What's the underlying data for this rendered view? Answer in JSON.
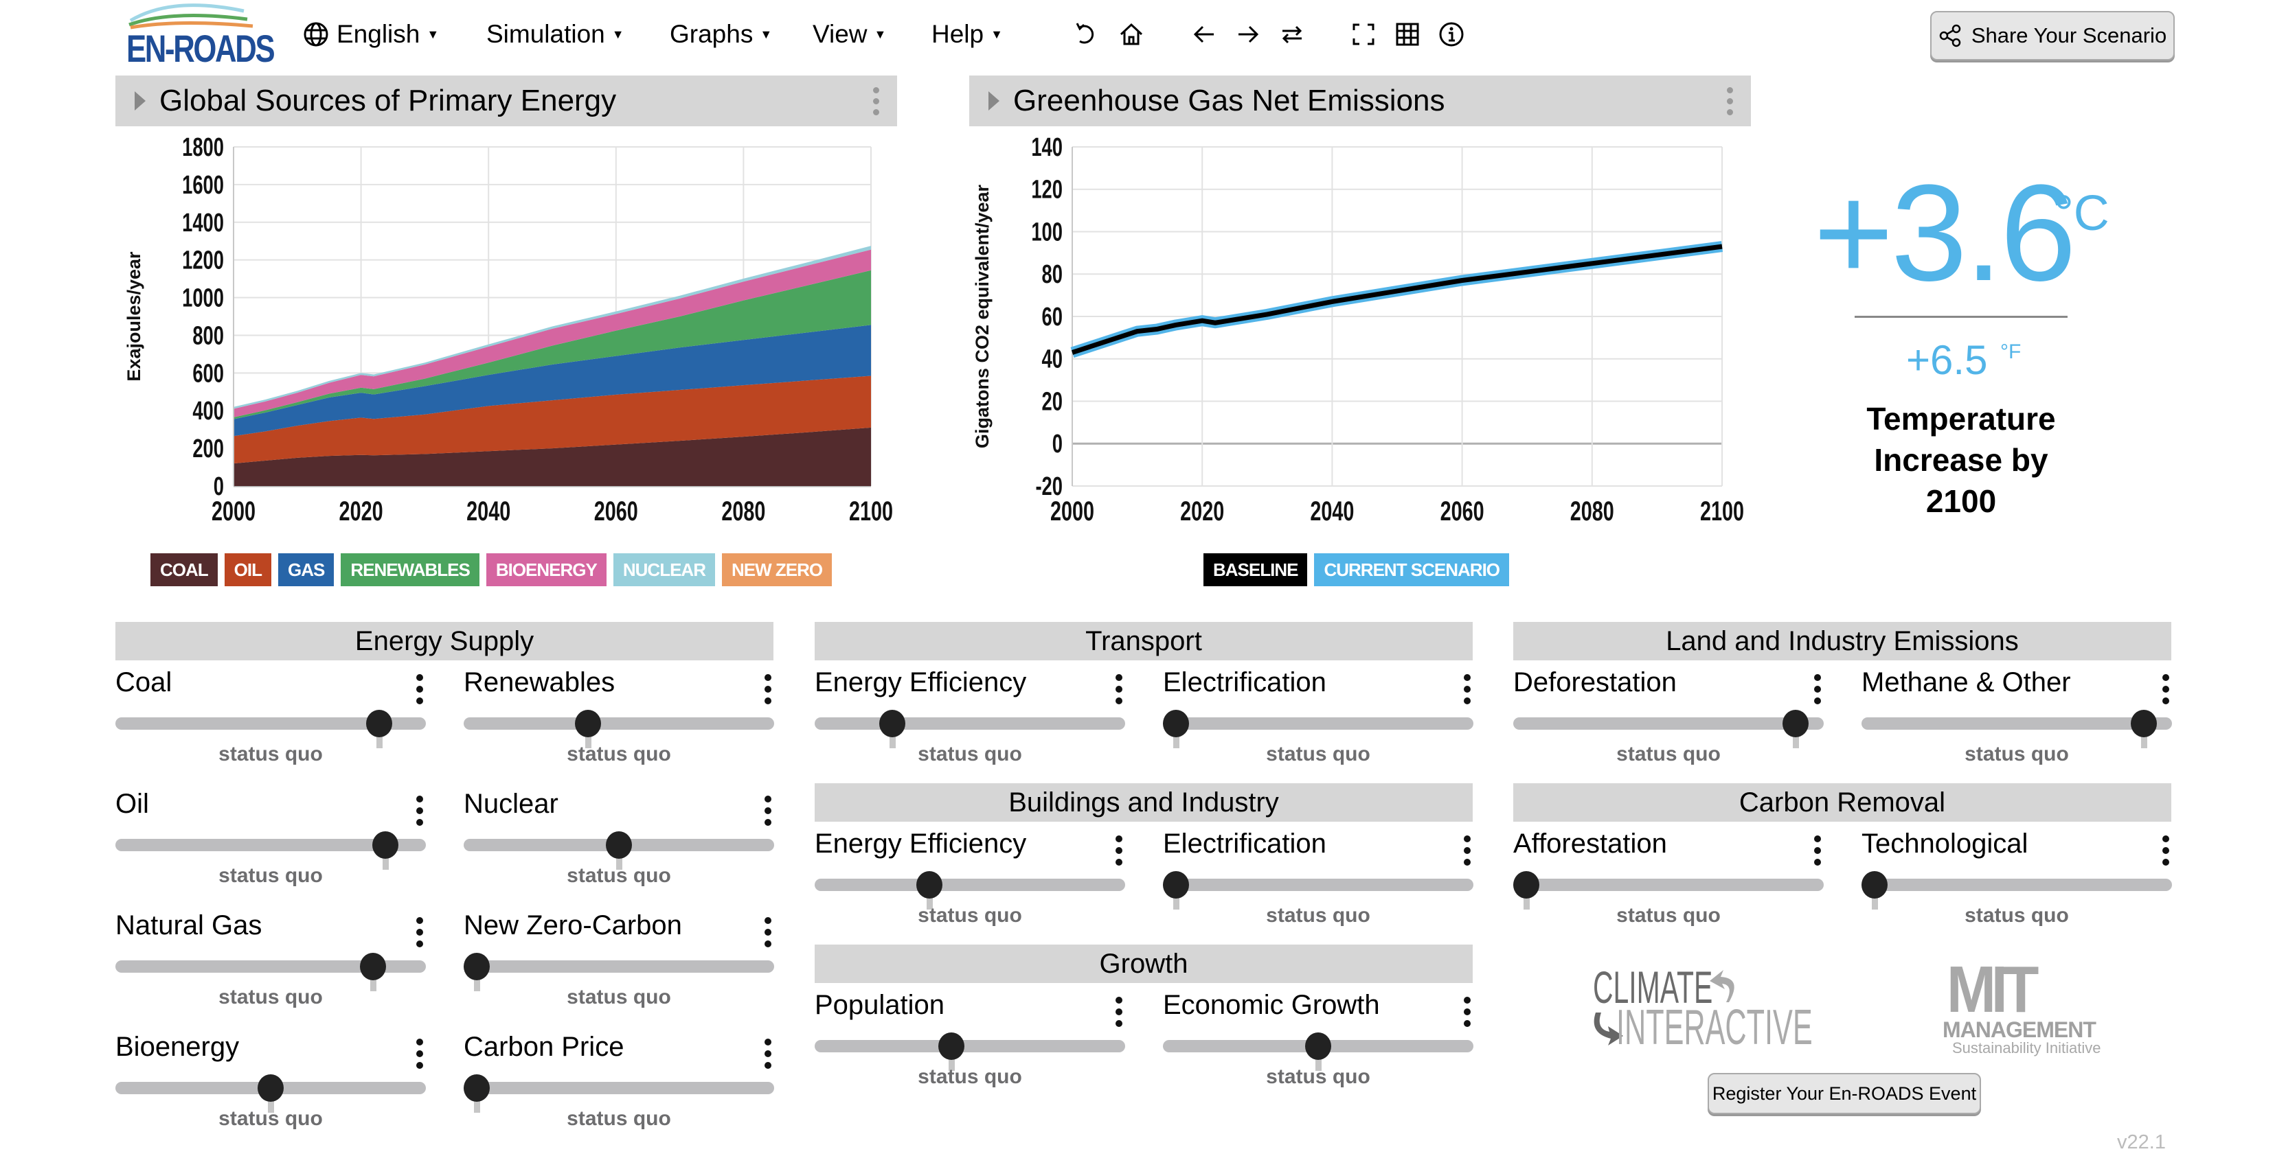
{
  "app": {
    "logo_text": "EN-ROADS",
    "version": "v22.1"
  },
  "menu": [
    {
      "label": "English",
      "icon": "globe-icon"
    },
    {
      "label": "Simulation"
    },
    {
      "label": "Graphs"
    },
    {
      "label": "View"
    },
    {
      "label": "Help"
    }
  ],
  "toolbar": {
    "icons": [
      "undo-icon",
      "home-icon",
      "back-arrow-icon",
      "forward-arrow-icon",
      "compare-icon",
      "fullscreen-icon",
      "table-icon",
      "info-icon"
    ],
    "share_label": "Share Your Scenario"
  },
  "charts": {
    "left_title": "Global Sources of Primary Energy",
    "right_title": "Greenhouse Gas Net Emissions"
  },
  "chart_data": [
    {
      "type": "area",
      "title": "Global Sources of Primary Energy",
      "xlabel": "",
      "ylabel": "Exajoules/year",
      "xlim": [
        2000,
        2100
      ],
      "ylim": [
        0,
        1800
      ],
      "yticks": [
        0,
        200,
        400,
        600,
        800,
        1000,
        1200,
        1400,
        1600,
        1800
      ],
      "xticks": [
        2000,
        2020,
        2040,
        2060,
        2080,
        2100
      ],
      "grid": true,
      "stacked": true,
      "x": [
        2000,
        2005,
        2010,
        2015,
        2020,
        2022,
        2030,
        2040,
        2050,
        2060,
        2070,
        2080,
        2090,
        2100
      ],
      "series": [
        {
          "name": "COAL",
          "color": "#532b2d",
          "values": [
            120,
            135,
            150,
            160,
            165,
            163,
            170,
            185,
            200,
            220,
            240,
            262,
            285,
            310
          ]
        },
        {
          "name": "OIL",
          "color": "#bc4521",
          "values": [
            145,
            155,
            170,
            185,
            198,
            193,
            210,
            240,
            255,
            265,
            270,
            273,
            275,
            275
          ]
        },
        {
          "name": "GAS",
          "color": "#2765a8",
          "values": [
            90,
            100,
            110,
            125,
            132,
            130,
            150,
            165,
            190,
            205,
            225,
            240,
            255,
            270
          ]
        },
        {
          "name": "RENEWABLES",
          "color": "#4ba45e",
          "values": [
            10,
            12,
            15,
            20,
            27,
            28,
            40,
            65,
            100,
            135,
            165,
            210,
            250,
            290
          ]
        },
        {
          "name": "BIOENERGY",
          "color": "#d565a0",
          "values": [
            45,
            47,
            50,
            58,
            68,
            68,
            75,
            85,
            90,
            88,
            95,
            100,
            105,
            110
          ]
        },
        {
          "name": "NUCLEAR",
          "color": "#97cfdb",
          "values": [
            10,
            10,
            10,
            10,
            10,
            10,
            10,
            12,
            12,
            14,
            15,
            16,
            17,
            20
          ]
        },
        {
          "name": "NEW ZERO",
          "color": "#eb9b61",
          "values": [
            0,
            0,
            0,
            0,
            0,
            0,
            0,
            0,
            0,
            0,
            0,
            0,
            0,
            0
          ]
        }
      ]
    },
    {
      "type": "line",
      "title": "Greenhouse Gas Net Emissions",
      "xlabel": "",
      "ylabel": "Gigatons CO2 equivalent/year",
      "xlim": [
        2000,
        2100
      ],
      "ylim": [
        -20,
        140
      ],
      "yticks": [
        -20,
        0,
        20,
        40,
        60,
        80,
        100,
        120,
        140
      ],
      "xticks": [
        2000,
        2020,
        2040,
        2060,
        2080,
        2100
      ],
      "grid": true,
      "x": [
        2000,
        2003,
        2006,
        2008,
        2010,
        2013,
        2016,
        2020,
        2022,
        2030,
        2040,
        2050,
        2060,
        2070,
        2080,
        2090,
        2100
      ],
      "series": [
        {
          "name": "BASELINE",
          "color": "#000000",
          "values": [
            43,
            46,
            49,
            51,
            53,
            54,
            56,
            58,
            57,
            61,
            67,
            72,
            77,
            81,
            85,
            89,
            93
          ]
        },
        {
          "name": "CURRENT SCENARIO",
          "color": "#52b4e8",
          "values": [
            43,
            46,
            49,
            51,
            53,
            54,
            56,
            58,
            57,
            61,
            67,
            72,
            77,
            81,
            85,
            89,
            93
          ]
        }
      ]
    }
  ],
  "temperature": {
    "celsius": "+3.6",
    "celsius_unit": "°C",
    "fahrenheit": "+6.5",
    "fahrenheit_unit": "°F",
    "label": "Temperature Increase by 2100"
  },
  "sections": [
    {
      "title": "Energy Supply"
    },
    {
      "title": "Transport"
    },
    {
      "title": "Buildings and Industry"
    },
    {
      "title": "Growth"
    },
    {
      "title": "Land and Industry Emissions"
    },
    {
      "title": "Carbon Removal"
    }
  ],
  "sliders": [
    {
      "label": "Coal",
      "value": 0.85,
      "status": "status quo"
    },
    {
      "label": "Renewables",
      "value": 0.4,
      "status": "status quo"
    },
    {
      "label": "Oil",
      "value": 0.87,
      "status": "status quo"
    },
    {
      "label": "Nuclear",
      "value": 0.5,
      "status": "status quo"
    },
    {
      "label": "Natural Gas",
      "value": 0.83,
      "status": "status quo"
    },
    {
      "label": "New Zero-Carbon",
      "value": 0.0,
      "status": "status quo"
    },
    {
      "label": "Bioenergy",
      "value": 0.5,
      "status": "status quo"
    },
    {
      "label": "Carbon Price",
      "value": 0.0,
      "status": "status quo"
    },
    {
      "label": "Energy Efficiency",
      "value": 0.25,
      "status": "status quo"
    },
    {
      "label": "Electrification",
      "value": 0.0,
      "status": "status quo"
    },
    {
      "label": "Energy Efficiency",
      "value": 0.37,
      "status": "status quo"
    },
    {
      "label": "Electrification",
      "value": 0.0,
      "status": "status quo"
    },
    {
      "label": "Population",
      "value": 0.44,
      "status": "status quo"
    },
    {
      "label": "Economic Growth",
      "value": 0.5,
      "status": "status quo"
    },
    {
      "label": "Deforestation",
      "value": 0.91,
      "status": "status quo"
    },
    {
      "label": "Methane & Other",
      "value": 0.91,
      "status": "status quo"
    },
    {
      "label": "Afforestation",
      "value": 0.0,
      "status": "status quo"
    },
    {
      "label": "Technological",
      "value": 0.0,
      "status": "status quo"
    }
  ],
  "footer": {
    "partner1": "CLIMATE INTERACTIVE",
    "partner1_line1": "CLIMATE",
    "partner1_line2": "INTERACTIVE",
    "partner2_line1": "MIT",
    "partner2_line2": "MANAGEMENT",
    "partner2_line3": "Sustainability Initiative",
    "register_label": "Register Your En-ROADS Event"
  }
}
